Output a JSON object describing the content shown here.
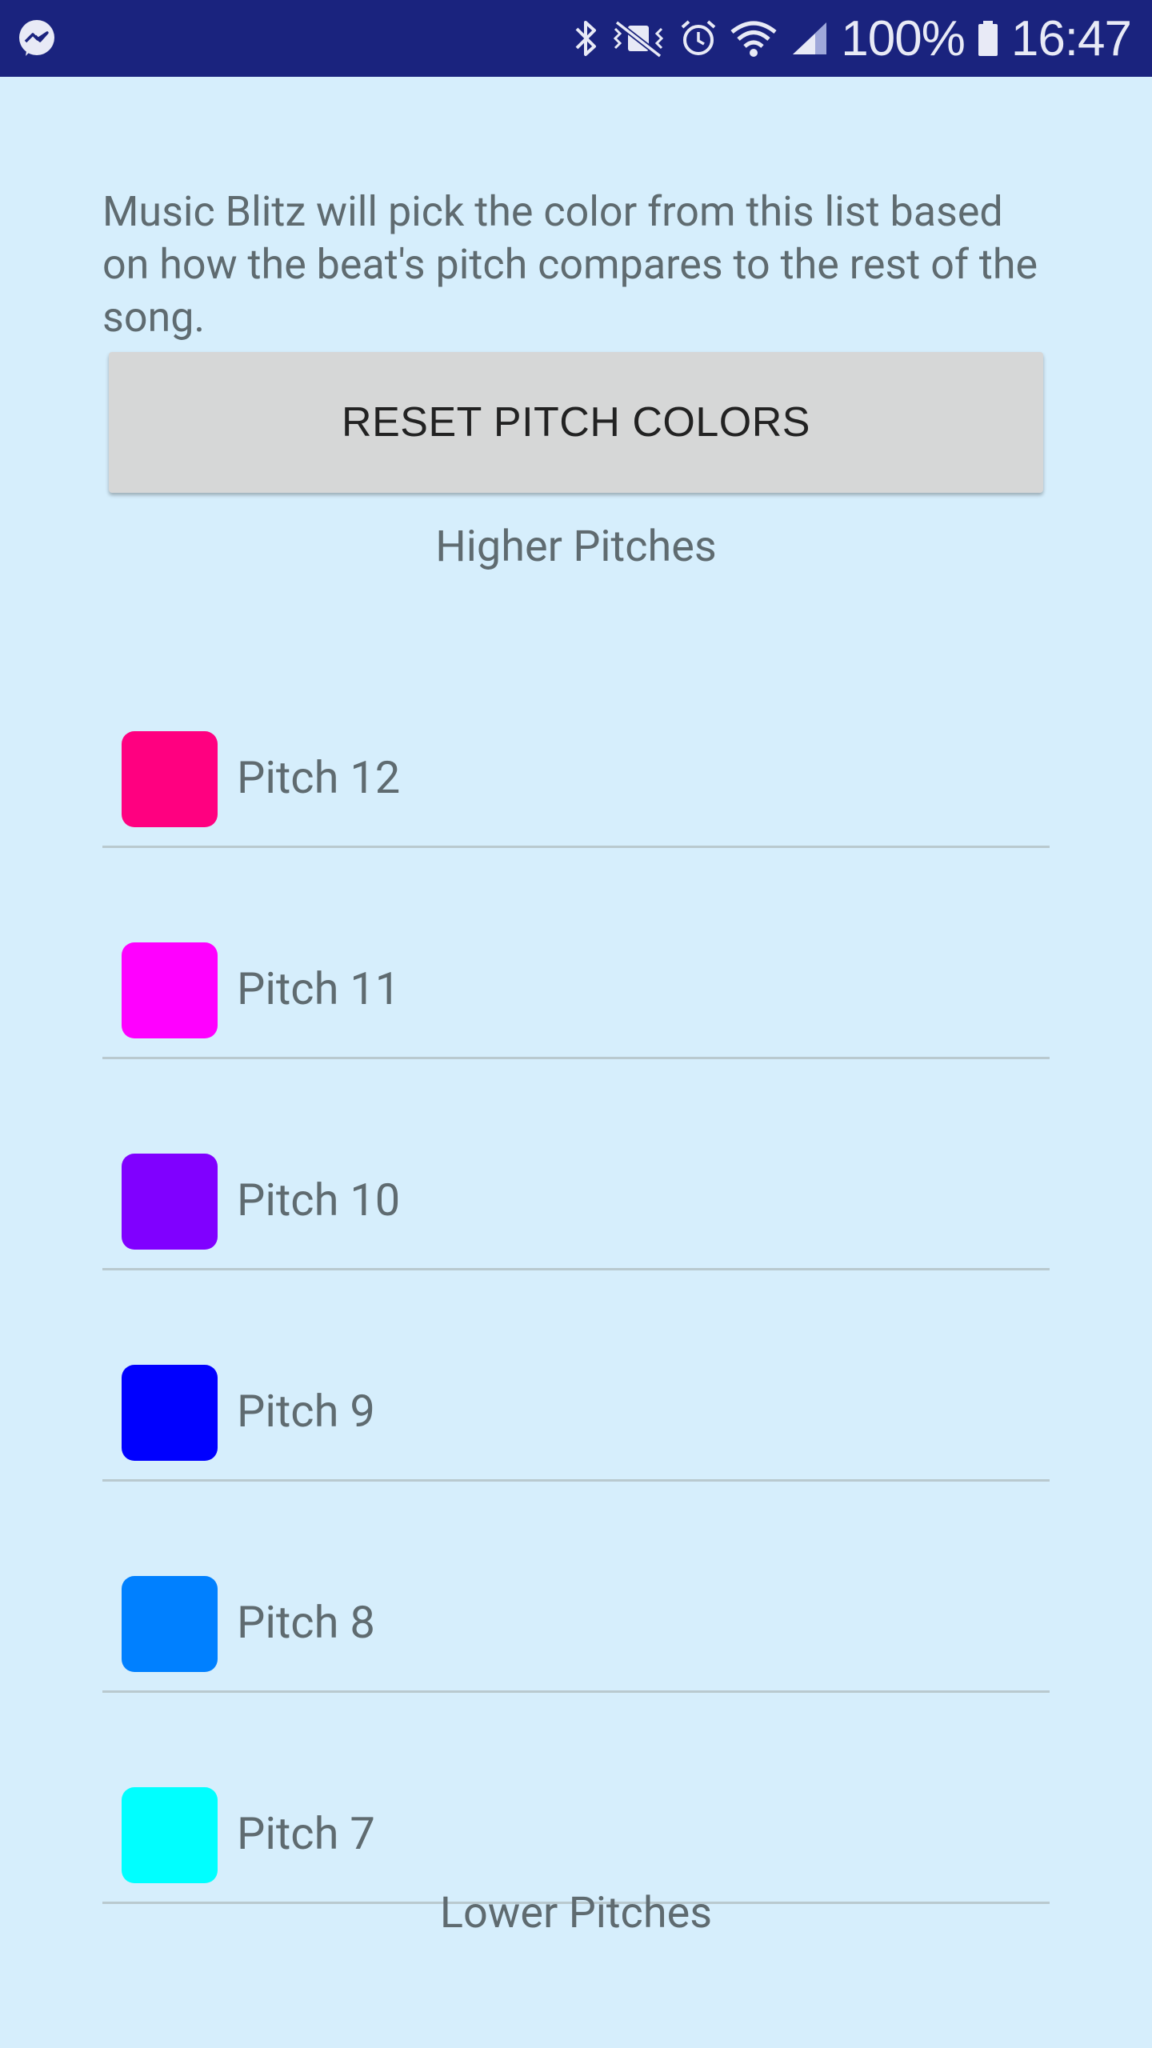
{
  "statusbar": {
    "battery": "100%",
    "time": "16:47",
    "background": "#1a237e"
  },
  "description": "Music Blitz will pick the color from this list based on how the beat's pitch compares to the rest of the song.",
  "reset_button_label": "RESET PITCH COLORS",
  "higher_label": "Higher Pitches",
  "lower_label": "Lower Pitches",
  "pitches": [
    {
      "label": "Pitch 12",
      "color": "#ff0080"
    },
    {
      "label": "Pitch 11",
      "color": "#ff00ff"
    },
    {
      "label": "Pitch 10",
      "color": "#8000ff"
    },
    {
      "label": "Pitch 9",
      "color": "#0000ff"
    },
    {
      "label": "Pitch 8",
      "color": "#0080ff"
    },
    {
      "label": "Pitch 7",
      "color": "#00ffff"
    }
  ],
  "colors": {
    "page_background": "#d6eefc",
    "text": "#5f6b70",
    "button_background": "#d6d7d7",
    "divider": "#b9c9cf"
  }
}
